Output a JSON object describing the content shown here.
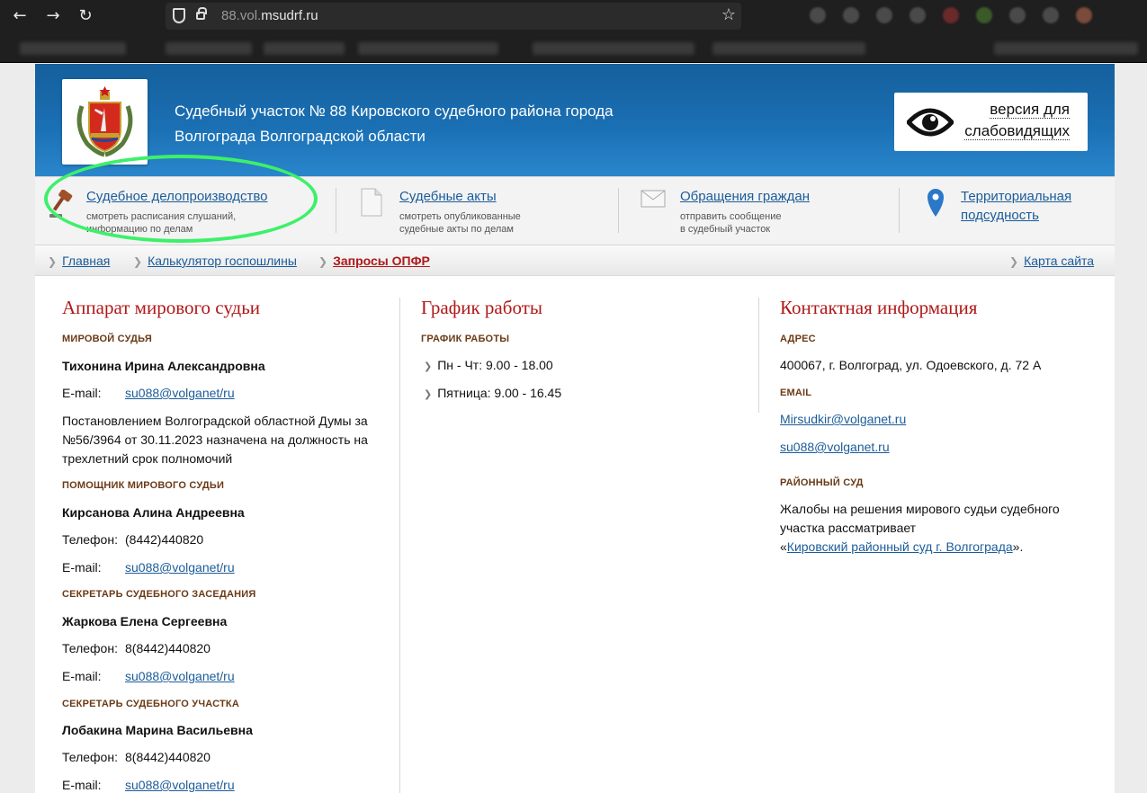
{
  "browser": {
    "url_prefix": "88.vol.",
    "url_domain": "msudrf.ru",
    "back_icon": "arrow-left-icon",
    "forward_icon": "arrow-right-icon",
    "reload_icon": "reload-icon",
    "bookmark_icon": "star-icon"
  },
  "header": {
    "title_line1": "Судебный участок № 88 Кировского судебного района города",
    "title_line2": "Волгограда Волгоградской области",
    "vision_line1": "версия для",
    "vision_line2": "слабовидящих"
  },
  "quicknav": [
    {
      "title": "Судебное делопроизводство",
      "sub1": "смотреть расписания слушаний,",
      "sub2": "информацию по делам",
      "icon": "gavel-icon"
    },
    {
      "title": "Судебные акты",
      "sub1": "смотреть опубликованные",
      "sub2": "судебные акты по делам",
      "icon": "document-icon"
    },
    {
      "title": "Обращения граждан",
      "sub1": "отправить сообщение",
      "sub2": "в судебный участок",
      "icon": "envelope-icon"
    },
    {
      "title1": "Территориальная",
      "title2": "подсудность",
      "icon": "map-pin-icon"
    }
  ],
  "breadcrumbs": {
    "home": "Главная",
    "calc": "Калькулятор госпошлины",
    "opfr": "Запросы ОПФР",
    "sitemap": "Карта сайта"
  },
  "apparatus": {
    "heading": "Аппарат мирового судьи",
    "judge_label": "МИРОВОЙ СУДЬЯ",
    "judge_name": "Тихонина Ирина Александровна",
    "judge_email_label": "E-mail:",
    "judge_email": "su088@volganet/ru",
    "appointment1": "Постановлением Волгоградской областной Думы за",
    "appointment2": "№56/3964 от 30.11.2023 назначена на должность на",
    "appointment3": "трехлетний срок полномочий",
    "assistant_label": "ПОМОЩНИК МИРОВОГО СУДЬИ",
    "assistant_name": "Кирсанова Алина Андреевна",
    "assistant_phone_label": "Телефон:",
    "assistant_phone": "(8442)440820",
    "assistant_email_label": "E-mail:",
    "assistant_email": "su088@volganet/ru",
    "secretary_session_label": "СЕКРЕТАРЬ СУДЕБНОГО ЗАСЕДАНИЯ",
    "secretary_session_name": "Жаркова Елена Сергеевна",
    "secretary_session_phone_label": "Телефон:",
    "secretary_session_phone": "8(8442)440820",
    "secretary_session_email_label": "E-mail:",
    "secretary_session_email": "su088@volganet/ru",
    "secretary_district_label": "СЕКРЕТАРЬ СУДЕБНОГО УЧАСТКА",
    "secretary_district_name": "Лобакина Марина Васильевна",
    "secretary_district_phone_label": "Телефон:",
    "secretary_district_phone": "8(8442)440820",
    "secretary_district_email_label": "E-mail:",
    "secretary_district_email": "su088@volganet/ru"
  },
  "schedule": {
    "heading": "График работы",
    "label": "ГРАФИК РАБОТЫ",
    "row1": "Пн - Чт: 9.00 - 18.00",
    "row2": "Пятница: 9.00 - 16.45"
  },
  "contacts": {
    "heading": "Контактная информация",
    "address_label": "АДРЕС",
    "address": "400067, г. Волгоград, ул. Одоевского, д. 72 А",
    "email_label": "EMAIL",
    "email1": "Mirsudkir@volganet.ru",
    "email2": "su088@volganet.ru",
    "district_label": "РАЙОННЫЙ СУД",
    "district_text1": "Жалобы на решения мирового судьи судебного",
    "district_text2": "участка рассматривает",
    "quote_open": "«",
    "district_link": "Кировский районный суд г. Волгограда",
    "quote_close": "»."
  },
  "colors": {
    "header_blue": "#1a6fb3",
    "heading_red": "#b01818",
    "link_blue": "#1b5c99",
    "label_brown": "#6b3a16",
    "annotation_green": "#3df06a"
  }
}
